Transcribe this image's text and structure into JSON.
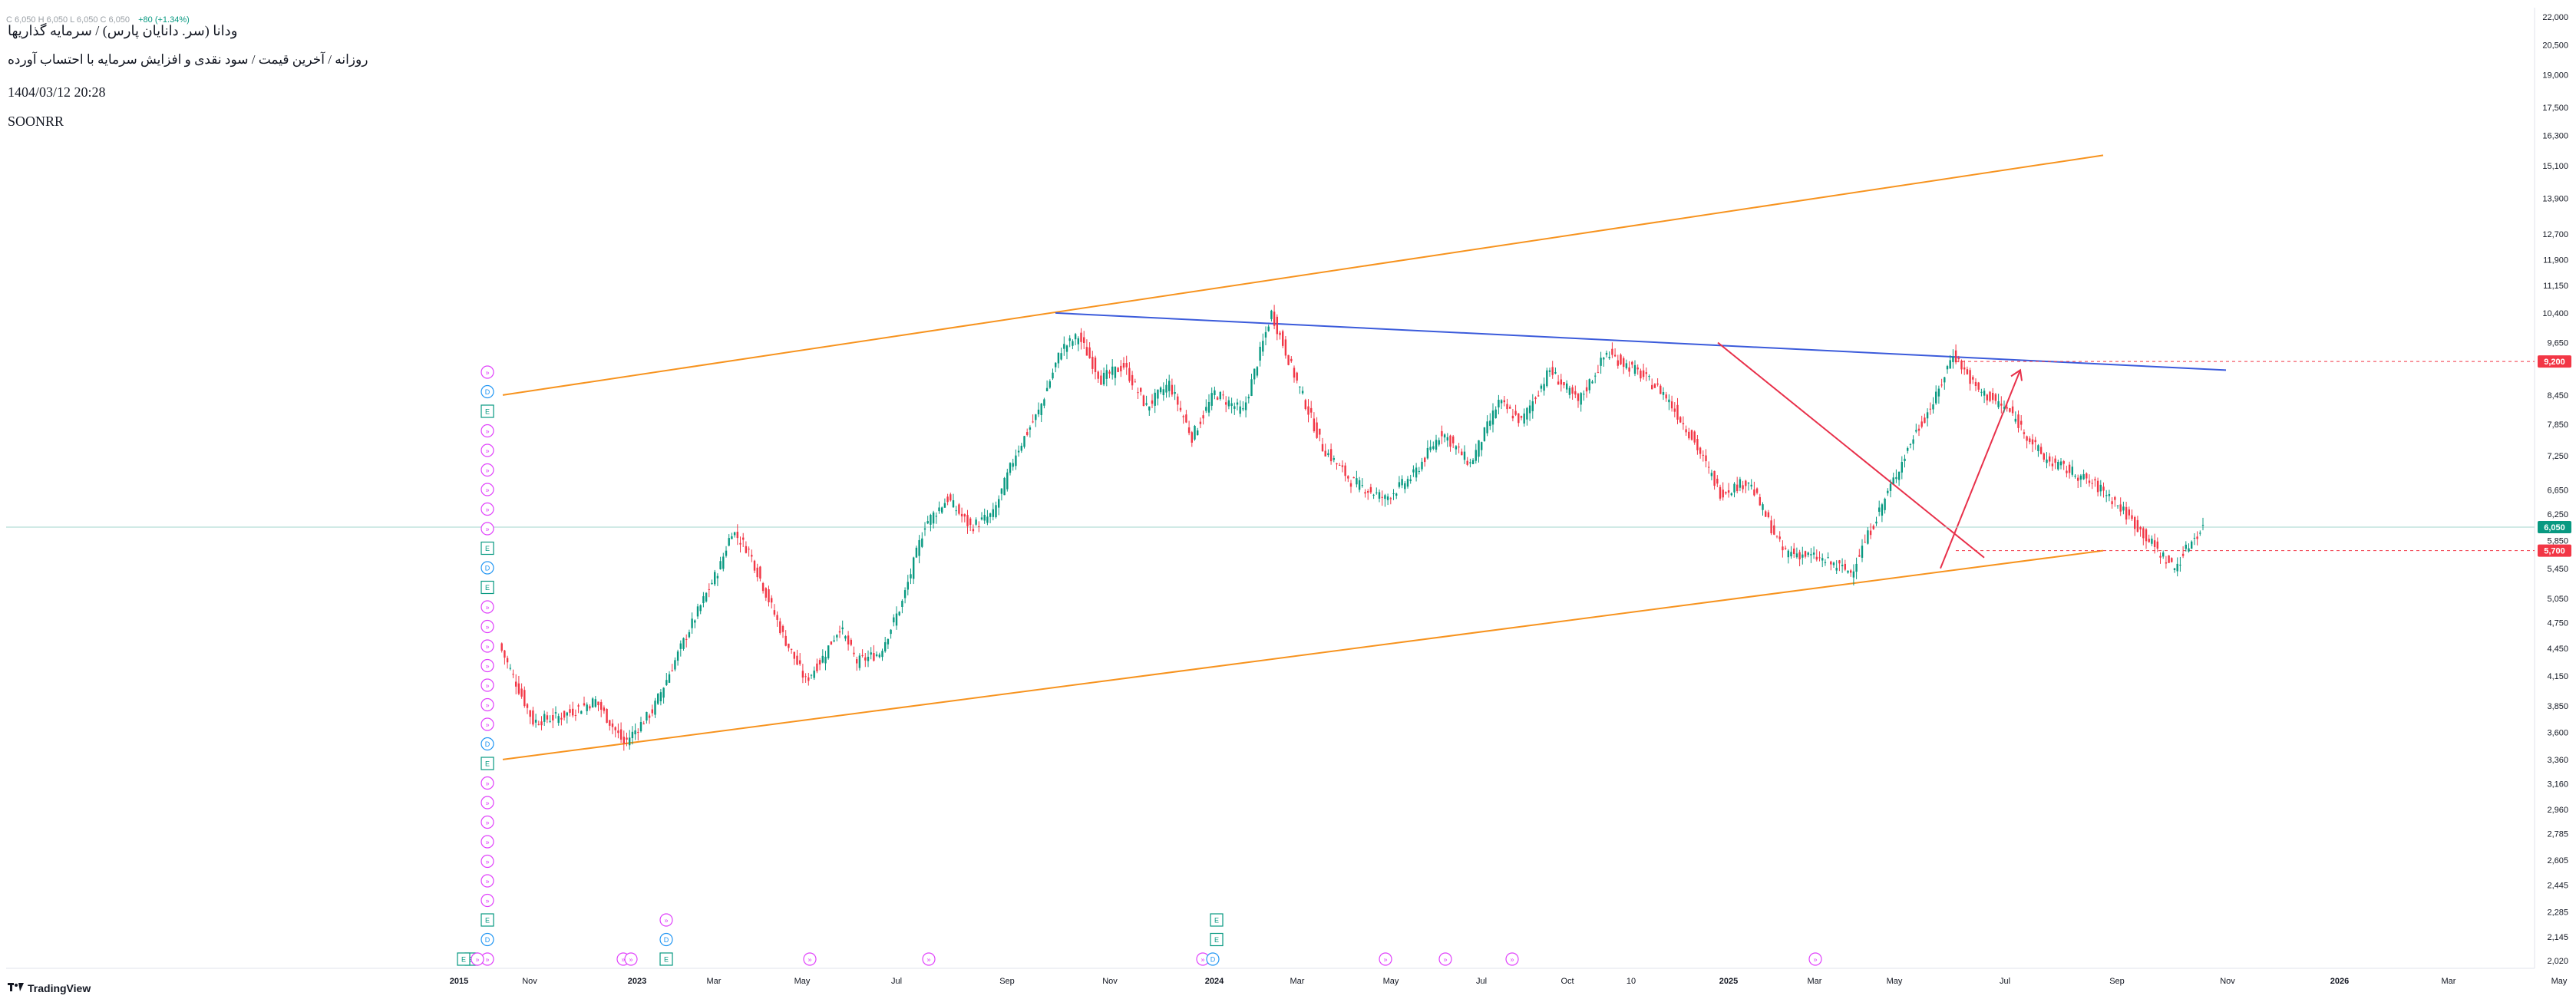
{
  "header": {
    "ohlc_partial": "C 6,050 H 6,050 L 6,050 C 6,050",
    "change": "+80 (+1.34%)",
    "title_line1": "ودانا (سر. دانایان پارس) / سرمایه گذاریها",
    "title_line2": "روزانه / آخرین قیمت / سود نقدی و افزایش سرمایه با احتساب آورده",
    "datetime": "1404/03/12 20:28",
    "symbol": "SOONRR"
  },
  "brand": {
    "name": "TradingView",
    "logo_icon": "tradingview-logo-icon"
  },
  "colors": {
    "channel": "#f7931e",
    "resistance": "#3b5bdb",
    "trend": "#e8304a",
    "up_candle": "#089981",
    "down_candle": "#f23645",
    "last_price_line": "#a3d6cc",
    "level_marker": "#f23645"
  },
  "price_tags": {
    "target": "9,200",
    "last": "6,050",
    "support": "5,700",
    "small_1": "5,850",
    "small_2": "5,700"
  },
  "chart_data": {
    "type": "candlestick",
    "y_scale": "log",
    "ylim": [
      2020,
      22000
    ],
    "y_ticks": [
      "22,000",
      "20,500",
      "19,000",
      "17,500",
      "16,300",
      "15,100",
      "13,900",
      "12,700",
      "11,900",
      "11,150",
      "10,400",
      "9,650",
      "8,450",
      "7,850",
      "7,250",
      "6,650",
      "6,250",
      "5,850",
      "5,450",
      "5,050",
      "4,750",
      "4,450",
      "4,150",
      "3,850",
      "3,600",
      "3,360",
      "3,160",
      "2,960",
      "2,785",
      "2,605",
      "2,445",
      "2,285",
      "2,145",
      "2,020"
    ],
    "x_ticks": [
      {
        "label": "2015",
        "bold": true
      },
      {
        "label": "Nov"
      },
      {
        "label": "2023",
        "bold": true
      },
      {
        "label": "Mar"
      },
      {
        "label": "May"
      },
      {
        "label": "Jul"
      },
      {
        "label": "Sep"
      },
      {
        "label": "Nov"
      },
      {
        "label": "2024",
        "bold": true
      },
      {
        "label": "Mar"
      },
      {
        "label": "May"
      },
      {
        "label": "Jul"
      },
      {
        "label": "Oct"
      },
      {
        "label": "10"
      },
      {
        "label": "2025",
        "bold": true
      },
      {
        "label": "Mar"
      },
      {
        "label": "May"
      },
      {
        "label": "Jul"
      },
      {
        "label": "Sep"
      },
      {
        "label": "Nov"
      },
      {
        "label": "2026",
        "bold": true
      },
      {
        "label": "Mar"
      },
      {
        "label": "May"
      }
    ],
    "price_path": [
      {
        "i": 0,
        "p": 4500
      },
      {
        "i": 12,
        "p": 3700
      },
      {
        "i": 22,
        "p": 3750
      },
      {
        "i": 34,
        "p": 3900
      },
      {
        "i": 44,
        "p": 3500
      },
      {
        "i": 54,
        "p": 3800
      },
      {
        "i": 66,
        "p": 4600
      },
      {
        "i": 78,
        "p": 5500
      },
      {
        "i": 82,
        "p": 6000
      },
      {
        "i": 88,
        "p": 5700
      },
      {
        "i": 100,
        "p": 4600
      },
      {
        "i": 108,
        "p": 4100
      },
      {
        "i": 114,
        "p": 4350
      },
      {
        "i": 120,
        "p": 4700
      },
      {
        "i": 126,
        "p": 4300
      },
      {
        "i": 134,
        "p": 4400
      },
      {
        "i": 142,
        "p": 5000
      },
      {
        "i": 150,
        "p": 6100
      },
      {
        "i": 158,
        "p": 6500
      },
      {
        "i": 166,
        "p": 6050
      },
      {
        "i": 174,
        "p": 6250
      },
      {
        "i": 182,
        "p": 7300
      },
      {
        "i": 190,
        "p": 8100
      },
      {
        "i": 198,
        "p": 9500
      },
      {
        "i": 204,
        "p": 9800
      },
      {
        "i": 212,
        "p": 8800
      },
      {
        "i": 220,
        "p": 9100
      },
      {
        "i": 228,
        "p": 8200
      },
      {
        "i": 236,
        "p": 8700
      },
      {
        "i": 244,
        "p": 7600
      },
      {
        "i": 252,
        "p": 8500
      },
      {
        "i": 262,
        "p": 8100
      },
      {
        "i": 272,
        "p": 10400
      },
      {
        "i": 280,
        "p": 8900
      },
      {
        "i": 290,
        "p": 7400
      },
      {
        "i": 300,
        "p": 6800
      },
      {
        "i": 312,
        "p": 6500
      },
      {
        "i": 322,
        "p": 6900
      },
      {
        "i": 332,
        "p": 7700
      },
      {
        "i": 342,
        "p": 7100
      },
      {
        "i": 352,
        "p": 8300
      },
      {
        "i": 360,
        "p": 7900
      },
      {
        "i": 370,
        "p": 9000
      },
      {
        "i": 380,
        "p": 8300
      },
      {
        "i": 390,
        "p": 9400
      },
      {
        "i": 400,
        "p": 9000
      },
      {
        "i": 410,
        "p": 8500
      },
      {
        "i": 420,
        "p": 7600
      },
      {
        "i": 430,
        "p": 6600
      },
      {
        "i": 440,
        "p": 6800
      },
      {
        "i": 452,
        "p": 5700
      },
      {
        "i": 464,
        "p": 5600
      },
      {
        "i": 476,
        "p": 5400
      },
      {
        "i": 486,
        "p": 6300
      },
      {
        "i": 498,
        "p": 7600
      },
      {
        "i": 506,
        "p": 8400
      },
      {
        "i": 512,
        "p": 9400
      },
      {
        "i": 520,
        "p": 8600
      },
      {
        "i": 532,
        "p": 8100
      },
      {
        "i": 544,
        "p": 7200
      },
      {
        "i": 556,
        "p": 6900
      },
      {
        "i": 566,
        "p": 6600
      },
      {
        "i": 576,
        "p": 6100
      },
      {
        "i": 584,
        "p": 5700
      },
      {
        "i": 590,
        "p": 5450
      },
      {
        "i": 596,
        "p": 5850
      },
      {
        "i": 600,
        "p": 6050
      }
    ],
    "channel_upper": {
      "x_frac": [
        0.0,
        1.0
      ],
      "p": [
        8450,
        15500
      ]
    },
    "channel_lower": {
      "x_frac": [
        0.0,
        1.0
      ],
      "p": [
        3360,
        5700
      ]
    },
    "resistance_line": {
      "p_start": 10400,
      "p_end": 9000
    },
    "down_trend": {
      "p_start": 9650,
      "p_end": 5600
    },
    "projection": {
      "p_start": 5450,
      "p_end": 9000
    },
    "target_level": 9200,
    "support_level": 5700,
    "last_price": 6050,
    "event_markers": [
      "D",
      "E",
      "R"
    ]
  }
}
